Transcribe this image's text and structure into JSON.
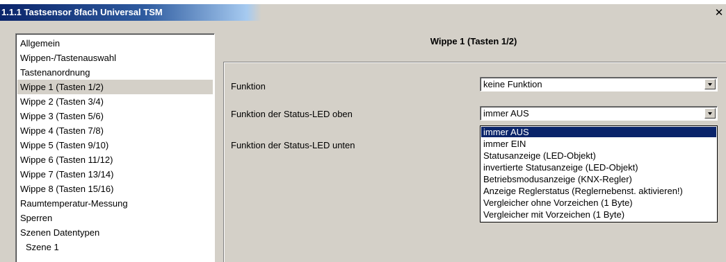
{
  "window": {
    "title": "1.1.1 Tastsensor 8fach Universal TSM",
    "close_label": "✕"
  },
  "nav": {
    "items": [
      "Allgemein",
      "Wippen-/Tastenauswahl",
      "Tastenanordnung",
      "Wippe 1 (Tasten 1/2)",
      "Wippe 2 (Tasten 3/4)",
      "Wippe 3 (Tasten 5/6)",
      "Wippe 4 (Tasten 7/8)",
      "Wippe 5 (Tasten 9/10)",
      "Wippe 6 (Tasten 11/12)",
      "Wippe 7 (Tasten 13/14)",
      "Wippe 8 (Tasten 15/16)",
      "Raumtemperatur-Messung",
      "Sperren",
      "Szenen Datentypen",
      "Szene 1"
    ],
    "selected": "Wippe 1 (Tasten 1/2)"
  },
  "panel": {
    "heading": "Wippe 1 (Tasten 1/2)",
    "params": [
      {
        "label": "Funktion",
        "value": "keine Funktion"
      },
      {
        "label": "Funktion der Status-LED oben",
        "value": "immer AUS"
      },
      {
        "label": "Funktion der Status-LED unten"
      }
    ]
  },
  "dropdown": {
    "options": [
      "immer AUS",
      "immer EIN",
      "Statusanzeige (LED-Objekt)",
      "invertierte Statusanzeige (LED-Objekt)",
      "Betriebsmodusanzeige (KNX-Regler)",
      "Anzeige Reglerstatus (Reglernebenst. aktivieren!)",
      "Vergleicher ohne Vorzeichen (1 Byte)",
      "Vergleicher mit Vorzeichen (1 Byte)"
    ],
    "selected": "immer AUS"
  },
  "colors": {
    "titlebar_start": "#0a246a",
    "selection": "#0a246a",
    "face": "#d4d0c8"
  }
}
